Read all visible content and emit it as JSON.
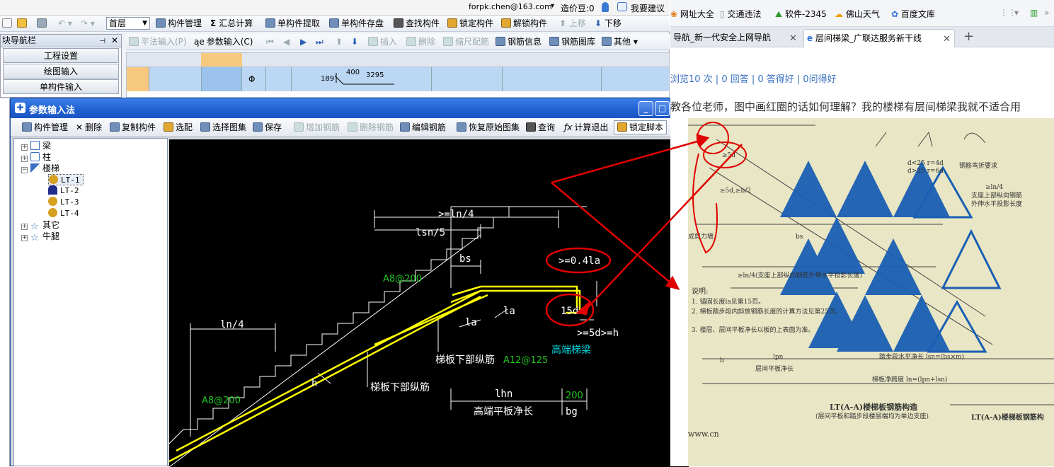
{
  "menubar": {
    "account": "forpk.chen@163.com",
    "account_caret": "▾",
    "cost_label": "造价豆:0",
    "suggest_label": "我要建议"
  },
  "toolbar1": {
    "floor_select": "首层",
    "items": [
      "构件管理",
      "汇总计算",
      "单构件提取",
      "单构件存盘",
      "查找构件",
      "锁定构件",
      "解锁构件",
      "上移",
      "下移"
    ]
  },
  "toolbar2": {
    "items": [
      "平法输入(P)",
      "参数输入(C)",
      "插入",
      "删除",
      "缩尺配筋",
      "钢筋信息",
      "钢筋图库",
      "其他"
    ]
  },
  "nav": {
    "title": "块导航栏",
    "buttons": [
      "工程设置",
      "绘图输入",
      "单构件输入"
    ]
  },
  "grid": {
    "row1": {
      "symbol": "Φ",
      "dim_a": "189",
      "dim_b": "400",
      "dim_c": "3295"
    }
  },
  "dialog": {
    "title": "参数输入法",
    "toolbar": [
      "构件管理",
      "删除",
      "复制构件",
      "选配",
      "选择图集",
      "保存",
      "增加钢筋",
      "删除钢筋",
      "编辑钢筋",
      "恢复原始图集",
      "查询",
      "计算退出",
      "锁定脚本"
    ],
    "more": "»"
  },
  "tree": {
    "nodes": [
      {
        "label": "梁",
        "expand": "+"
      },
      {
        "label": "柱",
        "expand": "+"
      },
      {
        "label": "楼梯",
        "expand": "−"
      },
      {
        "label": "LT-1"
      },
      {
        "label": "LT-2"
      },
      {
        "label": "LT-3"
      },
      {
        "label": "LT-4"
      },
      {
        "label": "其它",
        "expand": "+"
      },
      {
        "label": "牛腿",
        "expand": "+"
      }
    ]
  },
  "drawing": {
    "top_len": ">=ln/4",
    "lsn": "lsn/5",
    "bs": "bs",
    "la04": ">=0.4la",
    "rebar_top": "A8@200",
    "la_right": "la",
    "la_left": "la",
    "hook": "15d",
    "five_d": ">=5d>=h",
    "beam": "高端梯梁",
    "ln4": "ln/4",
    "bottom_rebar_label": "梯板下部纵筋",
    "bottom_rebar_value": "A12@125",
    "h": "h",
    "bottom_long": "梯板下部纵筋",
    "rebar_bottom": "A8@200",
    "lhn": "lhn",
    "lhn_desc": "高端平板净长",
    "bg_val": "200",
    "bg": "bg"
  },
  "browser": {
    "bookmarks": [
      "网址大全",
      "交通违法",
      "软件-2345",
      "佛山天气",
      "百度文库"
    ],
    "tabs": [
      {
        "label": "导航_新一代安全上网导航"
      },
      {
        "label": "层间梯梁_广联达服务新干线"
      }
    ],
    "new_tab": "+",
    "stats": "浏览10 次 | 0 回答 | 0 答得好 | 0问得好",
    "question": "教各位老师，图中画红圈的话如何理解？我的楼梯有层间梯梁我就不适合用"
  },
  "scan": {
    "labels": [
      "d<25 r=4d",
      "d>25 r=6d",
      "钢筋弯折要求",
      "≥ln/4",
      "支座上部纵向钢筋",
      "外伸水平投影长度",
      "说明:",
      "1. 锚固长度la见第15页。",
      "2. 梯板踏步段内斜放钢筋长度的计算方法见第25页。",
      "3. 楼层、层间平板净长以板的上表面为准。",
      "踏步段水平净长 lsn=(bs×m)",
      "梯板净跨度 ln=(lpn+lsn)",
      "层间平板净长",
      "LT(A-A)楼梯板钢筋构造",
      "(层间平板和踏步段楼层端均为单边支座)",
      "LT(A-A)楼梯板钢筋构",
      "≥5d,≥b/2",
      "成剪力墙",
      "lpn",
      "b",
      "≥5d",
      "bs",
      "≥ln/4(支座上部纵向钢筋外伸水平投影长度)",
      "www.cn"
    ]
  },
  "colors": {
    "rebar": "#ffff00",
    "annot_red": "#e00000",
    "dim_white": "#ffffff",
    "label_green": "#22c322",
    "label_cyan": "#00d7e0",
    "watermark": "#1a5fb4"
  }
}
